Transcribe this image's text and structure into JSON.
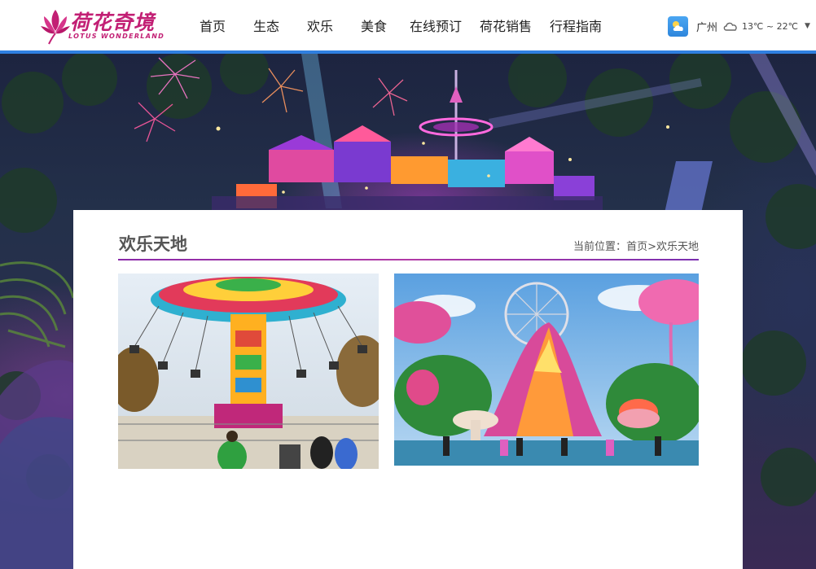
{
  "header": {
    "logo": {
      "name_cn": "荷花奇境",
      "name_en": "LOTUS WONDERLAND"
    },
    "nav": [
      {
        "label": "首页"
      },
      {
        "label": "生态"
      },
      {
        "label": "欢乐"
      },
      {
        "label": "美食"
      },
      {
        "label": "在线预订"
      },
      {
        "label": "荷花销售"
      },
      {
        "label": "行程指南"
      }
    ],
    "weather": {
      "icon": "weather-sun-cloud-icon",
      "city": "广州",
      "condition_icon": "cloud-icon",
      "temperature": "13℃ ~ 22℃",
      "dropdown_icon": "caret-down-icon"
    }
  },
  "content": {
    "title": "欢乐天地",
    "breadcrumb": {
      "prefix": "当前位置：",
      "home": "首页",
      "separator": ">",
      "current": "欢乐天地"
    },
    "photos": [
      {
        "subject": "swing-carousel-ride"
      },
      {
        "subject": "fantasy-lotus-park"
      }
    ]
  },
  "colors": {
    "brand": "#c21f74",
    "header_line": "#2f7fe0",
    "title_rule": "#8a2aa8"
  }
}
